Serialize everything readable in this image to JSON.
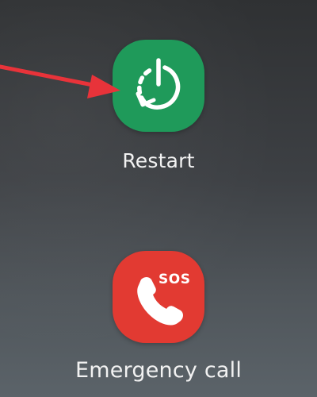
{
  "power_menu": {
    "restart": {
      "label": "Restart",
      "icon": "restart-icon",
      "color": "#1f9a5a"
    },
    "emergency": {
      "label": "Emergency call",
      "icon": "emergency-call-icon",
      "badge": "SOS",
      "color": "#e23a32"
    }
  },
  "annotation": {
    "icon": "red-arrow-pointer",
    "color": "#e8333a"
  }
}
